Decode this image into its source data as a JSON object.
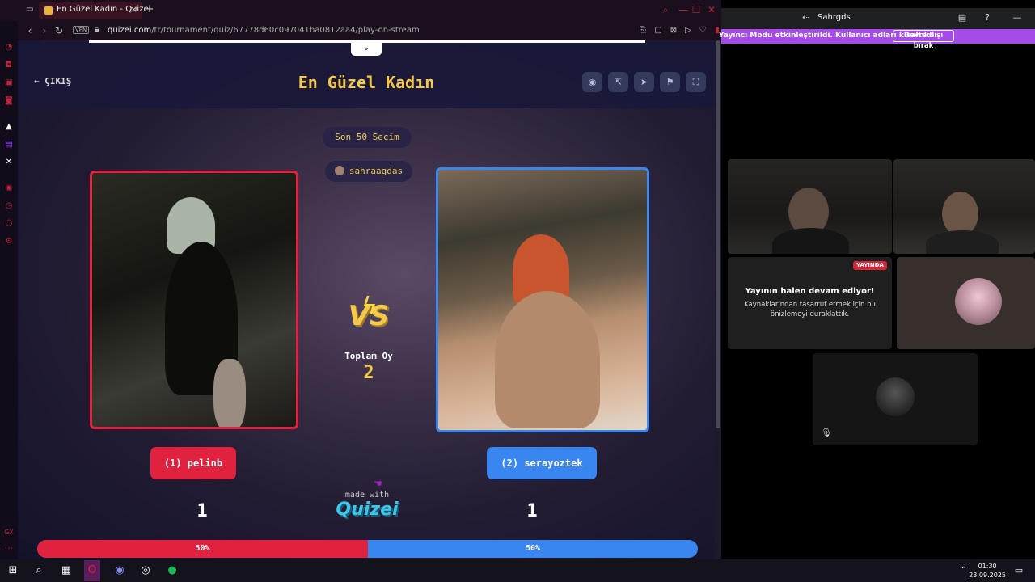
{
  "browser": {
    "tab_title": "En Güzel Kadın - Quizei",
    "new_tab": "+",
    "vpn": "VPN",
    "url_domain": "quizei.com",
    "url_path": "/tr/tournament/quiz/67778d60c097041ba0812aa4/play-on-stream"
  },
  "quiz": {
    "back_label": "← ÇIKIŞ",
    "title": "En Güzel Kadın",
    "last_choices": "Son 50 Seçim",
    "creator": "sahraagdas",
    "vs": "VS",
    "total_label": "Toplam Oy",
    "total_value": "2",
    "left_choice": "(1) pelinb",
    "right_choice": "(2) serayoztek",
    "left_count": "1",
    "right_count": "1",
    "made_with": "made with",
    "brand": "Quizei",
    "left_percent_label": "50%",
    "right_percent_label": "50%",
    "left_percent": 50
  },
  "discord": {
    "title": "Sahrgds",
    "banner_text": "Yayıncı Modu etkinleştirildi. Kullanıcı adları kısaltıldı.",
    "banner_button": "Devre dışı bırak",
    "live_badge": "YAYINDA",
    "live_title": "Yayının halen devam ediyor!",
    "live_sub": "Kaynaklarından tasarruf etmek için bu önizlemeyi duraklattık."
  },
  "taskbar": {
    "time": "01:30",
    "date": "23.09.2025"
  },
  "colors": {
    "accent_red": "#e0223f",
    "accent_blue": "#3a86f0",
    "accent_yellow": "#f2c94c"
  }
}
